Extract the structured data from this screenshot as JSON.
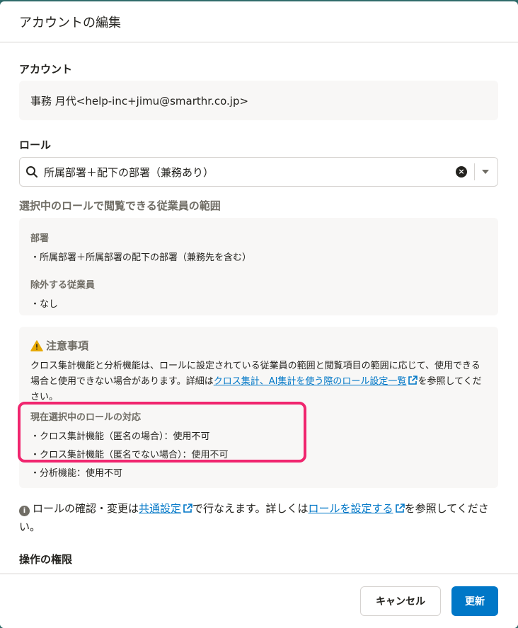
{
  "modal": {
    "title": "アカウントの編集"
  },
  "account": {
    "section_title": "アカウント",
    "value": "事務 月代<help-inc+jimu@smarthr.co.jp>"
  },
  "role": {
    "section_title": "ロール",
    "selected": "所属部署＋配下の部署（兼務あり）"
  },
  "scope": {
    "title": "選択中のロールで閲覧できる従業員の範囲",
    "department_label": "部署",
    "department_value": "・所属部署＋所属部署の配下の部署（兼務先を含む）",
    "excluded_label": "除外する従業員",
    "excluded_value": "・なし"
  },
  "notice": {
    "title": "注意事項",
    "text_before_link": "クロス集計機能と分析機能は、ロールに設定されている従業員の範囲と閲覧項目の範囲に応じて、使用できる場合と使用できない場合があります。詳細は",
    "link": "クロス集計、AI集計を使う際のロール設定一覧",
    "text_after_link": "を参照してください。",
    "current_title": "現在選択中のロールの対応",
    "items": [
      "・クロス集計機能（匿名の場合）：使用不可",
      "・クロス集計機能（匿名でない場合）：使用不可",
      "・分析機能：使用不可"
    ]
  },
  "info": {
    "text1": "ロールの確認・変更は",
    "link1": "共通設定",
    "text2": "で行なえます。詳しくは",
    "link2": "ロールを設定する",
    "text3": "を参照してください。"
  },
  "permissions": {
    "section_title": "操作の権限"
  },
  "footer": {
    "cancel_label": "キャンセル",
    "update_label": "更新"
  },
  "colors": {
    "primary": "#0077c7",
    "highlight": "#f0256e",
    "warning": "#e6a700"
  }
}
